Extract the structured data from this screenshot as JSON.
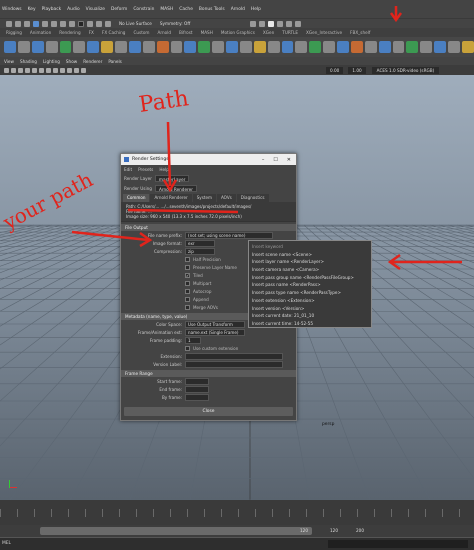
{
  "menubar": [
    "Windows",
    "Key",
    "Playback",
    "Audio",
    "Visualize",
    "Deform",
    "Constrain",
    "MASH",
    "Cache",
    "Bonus Tools",
    "Arnold",
    "Help"
  ],
  "status": {
    "live_surface": "No Live Surface",
    "symmetry": "Symmetry: Off"
  },
  "shelf_tabs": [
    "Rigging",
    "Animation",
    "Rendering",
    "FX",
    "FX Caching",
    "Custom",
    "Arnold",
    "Bifrost",
    "MASH",
    "Motion Graphics",
    "XGen",
    "TURTLE",
    "XGen_Interactive",
    "FBX_shelf"
  ],
  "panel_menu": [
    "View",
    "Shading",
    "Lighting",
    "Show",
    "Renderer",
    "Panels"
  ],
  "panel_values": {
    "near": "0.00",
    "far": "1.00",
    "colorspace": "ACES 1.0 SDR-video (sRGB)"
  },
  "viewport": {
    "camera_label": "persp"
  },
  "time": {
    "current": "120",
    "end_a": "120",
    "end_b": "200",
    "cmd_label": "MEL"
  },
  "dialog": {
    "title": "Render Settings",
    "menu": [
      "Edit",
      "Presets",
      "Help"
    ],
    "render_layer_label": "Render Layer",
    "render_layer_value": "masterLayer",
    "render_using_label": "Render Using",
    "render_using_value": "Arnold Renderer",
    "tabs": [
      "Common",
      "Arnold Renderer",
      "System",
      "AOVs",
      "Diagnostics"
    ],
    "path_line": "Path: C:/Users/...  .../...seventh/images/projects/default/images/",
    "file_line": "File name: ...",
    "image_size": "Image size: 960 x 540 (13.3 x 7.5 inches 72.0 pixels/inch)",
    "file_output_header": "File Output",
    "file_name_prefix_label": "File name prefix:",
    "file_name_prefix_value": "(not set; using scene name)",
    "image_format_label": "Image format:",
    "image_format_value": "exr",
    "compression_label": "Compression:",
    "compression_value": "zip",
    "checkboxes": [
      {
        "label": "Half Precision",
        "checked": false
      },
      {
        "label": "Preserve Layer Name",
        "checked": false
      },
      {
        "label": "Tiled",
        "checked": true
      },
      {
        "label": "Multipart",
        "checked": false
      },
      {
        "label": "Autocrop",
        "checked": false
      },
      {
        "label": "Append",
        "checked": false
      },
      {
        "label": "Merge AOVs",
        "checked": false
      }
    ],
    "metadata_header": "Metadata (name, type, value)",
    "color_space_label": "Color Space:",
    "color_space_value": "Use Output Transform",
    "frame_ext_label": "Frame/Animation ext:",
    "frame_ext_value": "name.ext (Single Frame)",
    "frame_padding_label": "Frame padding:",
    "frame_padding_value": "1",
    "custom_ext_label": "Use custom extension",
    "extension_label": "Extension:",
    "version_label": "Version Label:",
    "frame_range_header": "Frame Range",
    "start_frame_label": "Start frame:",
    "end_frame_label": "End frame:",
    "by_frame_label": "By frame:",
    "close_label": "Close"
  },
  "popup": {
    "header": "Insert keyword",
    "items": [
      "Insert scene name <Scene>",
      "Insert layer name <RenderLayer>",
      "Insert camera name <Camera>",
      "Insert pass group name <RenderPassFileGroup>",
      "Insert pass name <RenderPass>",
      "Insert pass type name <RenderPassType>",
      "Insert extension <Extension>",
      "Insert version <Version>",
      "Insert current date: 21_01_10",
      "Insert current time: 14-52-55"
    ]
  },
  "annotations": {
    "path_word": "Path",
    "your_path_word": "your path"
  },
  "colors": {
    "annotation_red": "#e0241c",
    "accent_blue": "#4a7fc1"
  }
}
